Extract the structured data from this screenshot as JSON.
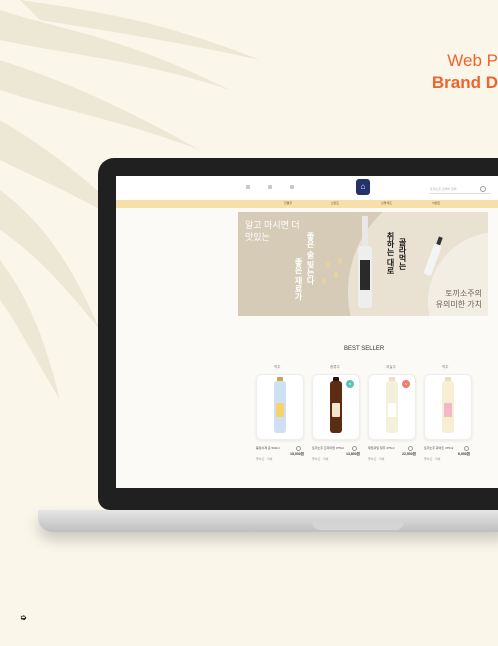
{
  "headline": {
    "line1": "Web P",
    "line2": "Brand D"
  },
  "site": {
    "logo": "",
    "search_placeholder": "토끼소주 검색어 입력",
    "nav": [
      "전통주",
      "브랜드",
      "선물세트",
      "이벤트"
    ]
  },
  "hero": {
    "text1": "알고 마시면 더 맛있는",
    "vertical1": "좋은 술 빚는다",
    "vertical2": "좋은 재료가",
    "vertical3": "취하는 대로",
    "vertical4": "골라먹는",
    "text2_line1": "토끼소주의",
    "text2_line2": "유의미한 가치"
  },
  "best_seller": {
    "title": "BEST SELLER",
    "products": [
      {
        "category": "약주",
        "name": "풍정사계 춘 500ml",
        "price": "15,000원",
        "meta": "좋아요 · 리뷰",
        "bottle": "#cfe0f2",
        "label": "#f3d36a",
        "neck": "#c8a84a"
      },
      {
        "category": "증류주",
        "name": "토끼소주 프리미엄 375ml",
        "price": "13,800원",
        "meta": "좋아요 · 리뷰",
        "bottle": "#5b2b12",
        "label": "#f1e7cf",
        "neck": "#2a140a",
        "badge": "B",
        "badge_color": "#5cc2b8"
      },
      {
        "category": "과실주",
        "name": "제철과일 청주 375ml",
        "price": "22,500원",
        "meta": "좋아요 · 리뷰",
        "bottle": "#f4f0dc",
        "label": "#ffffff",
        "neck": "#e8e0c8",
        "badge": "N",
        "badge_color": "#f27a6e"
      },
      {
        "category": "약주",
        "name": "토끼소주 화이트 375ml",
        "price": "6,900원",
        "meta": "좋아요 · 리뷰",
        "bottle": "#f7eed6",
        "label": "#f2b8c6",
        "neck": "#e7dcc0"
      }
    ]
  },
  "corner_mark": "➭"
}
